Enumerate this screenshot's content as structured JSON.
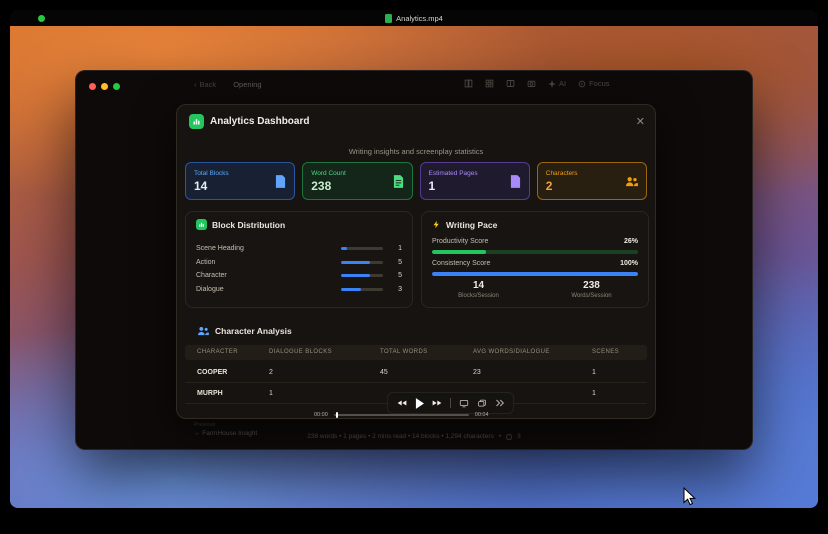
{
  "menu_bar": {
    "title": "Analytics.mp4"
  },
  "icons": {
    "back_chevron": "‹",
    "close": "✕"
  },
  "colors": {
    "blue": "#3b82f6",
    "green": "#22c55e",
    "purple": "#8b5cf6",
    "orange": "#f59e0b"
  },
  "window": {
    "toolbar": {
      "back_label": "Back",
      "doc_title": "Opening",
      "ai_label": "AI",
      "focus_label": "Focus"
    },
    "player": {
      "time_current": "00:00",
      "time_total": "00:04"
    },
    "status_bar": {
      "nav_eyebrow": "Previous",
      "nav_label": "← FarmHouse Insight",
      "stats": "238 words    •    1 pages    •    2 mins read    •    14 blocks    •    1,294 characters",
      "sep": "•",
      "right_count": "3"
    }
  },
  "modal": {
    "title": "Analytics Dashboard",
    "subtitle": "Writing insights and screenplay statistics",
    "stat_cards": [
      {
        "label": "Total Blocks",
        "value": "14",
        "color": "#3b82f6"
      },
      {
        "label": "Word Count",
        "value": "238",
        "color": "#22c55e"
      },
      {
        "label": "Estimated Pages",
        "value": "1",
        "color": "#8b5cf6"
      },
      {
        "label": "Characters",
        "value": "2",
        "color": "#f59e0b"
      }
    ],
    "block_distribution": {
      "title": "Block Distribution",
      "rows": [
        {
          "label": "Scene Heading",
          "value": "1",
          "pct": 15
        },
        {
          "label": "Action",
          "value": "5",
          "pct": 68
        },
        {
          "label": "Character",
          "value": "5",
          "pct": 68
        },
        {
          "label": "Dialogue",
          "value": "3",
          "pct": 48
        }
      ]
    },
    "writing_pace": {
      "title": "Writing Pace",
      "metrics": [
        {
          "label": "Productivity Score",
          "value": "26%",
          "pct": 26,
          "color": "#22c55e"
        },
        {
          "label": "Consistency Score",
          "value": "100%",
          "pct": 100,
          "color": "#3b82f6"
        }
      ],
      "session_stats": [
        {
          "value": "14",
          "label": "Blocks/Session"
        },
        {
          "value": "238",
          "label": "Words/Session"
        }
      ]
    },
    "character_analysis": {
      "title": "Character Analysis",
      "columns": [
        "CHARACTER",
        "DIALOGUE BLOCKS",
        "TOTAL WORDS",
        "AVG WORDS/DIALOGUE",
        "SCENES"
      ],
      "rows": [
        [
          "COOPER",
          "2",
          "45",
          "23",
          "1"
        ],
        [
          "MURPH",
          "1",
          "",
          "",
          "1"
        ]
      ]
    }
  }
}
